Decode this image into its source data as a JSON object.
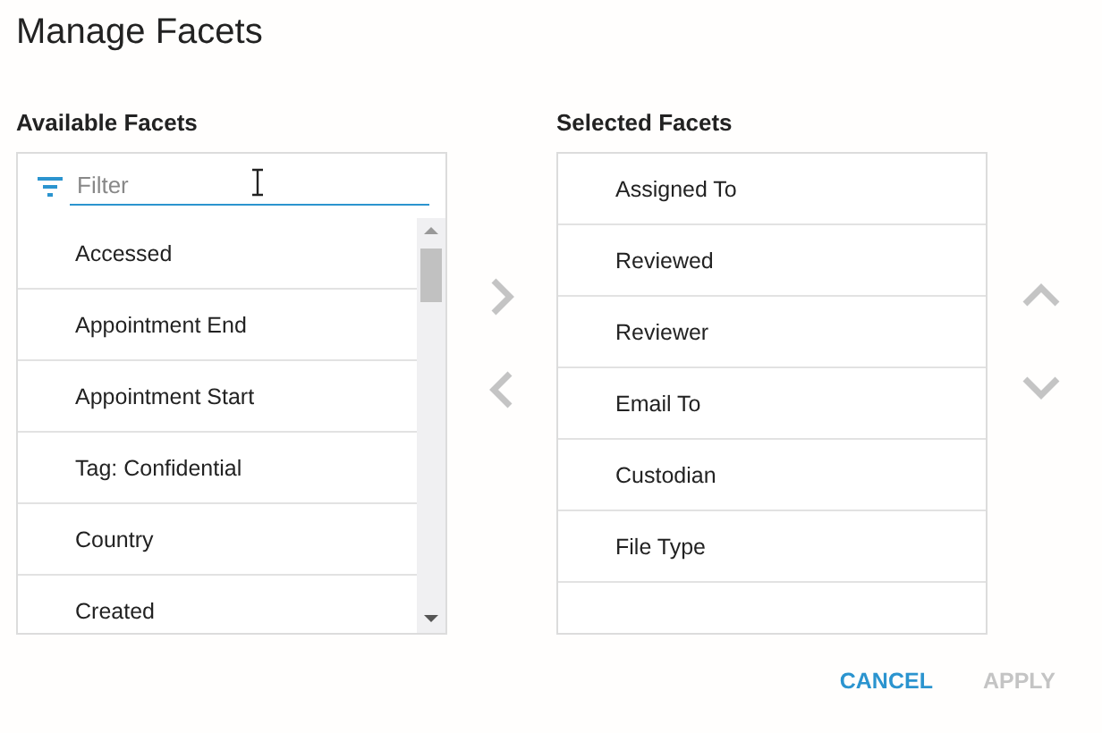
{
  "dialog": {
    "title": "Manage Facets"
  },
  "available": {
    "heading": "Available Facets",
    "filter": {
      "placeholder": "Filter"
    },
    "items": [
      {
        "label": "Accessed",
        "selected": false
      },
      {
        "label": "Appointment End",
        "selected": false
      },
      {
        "label": "Appointment Start",
        "selected": false
      },
      {
        "label": "Tag: Confidential",
        "selected": false
      },
      {
        "label": "Country",
        "selected": false
      },
      {
        "label": "Created",
        "selected": false
      }
    ]
  },
  "transfer_buttons": [
    {
      "kind": "right",
      "disabled": true
    },
    {
      "kind": "left",
      "disabled": true
    }
  ],
  "selected_facets": {
    "heading": "Selected Facets",
    "items": [
      {
        "label": "Assigned To",
        "selected": false
      },
      {
        "label": "Reviewed",
        "selected": false
      },
      {
        "label": "Reviewer",
        "selected": false
      },
      {
        "label": "Email To",
        "selected": false
      },
      {
        "label": "Custodian",
        "selected": false
      },
      {
        "label": "File Type",
        "selected": false
      }
    ]
  },
  "order_buttons": [
    {
      "kind": "up",
      "disabled": true
    },
    {
      "kind": "down",
      "disabled": true
    }
  ],
  "actions": [
    {
      "label": "CANCEL",
      "disabled": false
    },
    {
      "label": "APPLY",
      "disabled": true
    }
  ]
}
